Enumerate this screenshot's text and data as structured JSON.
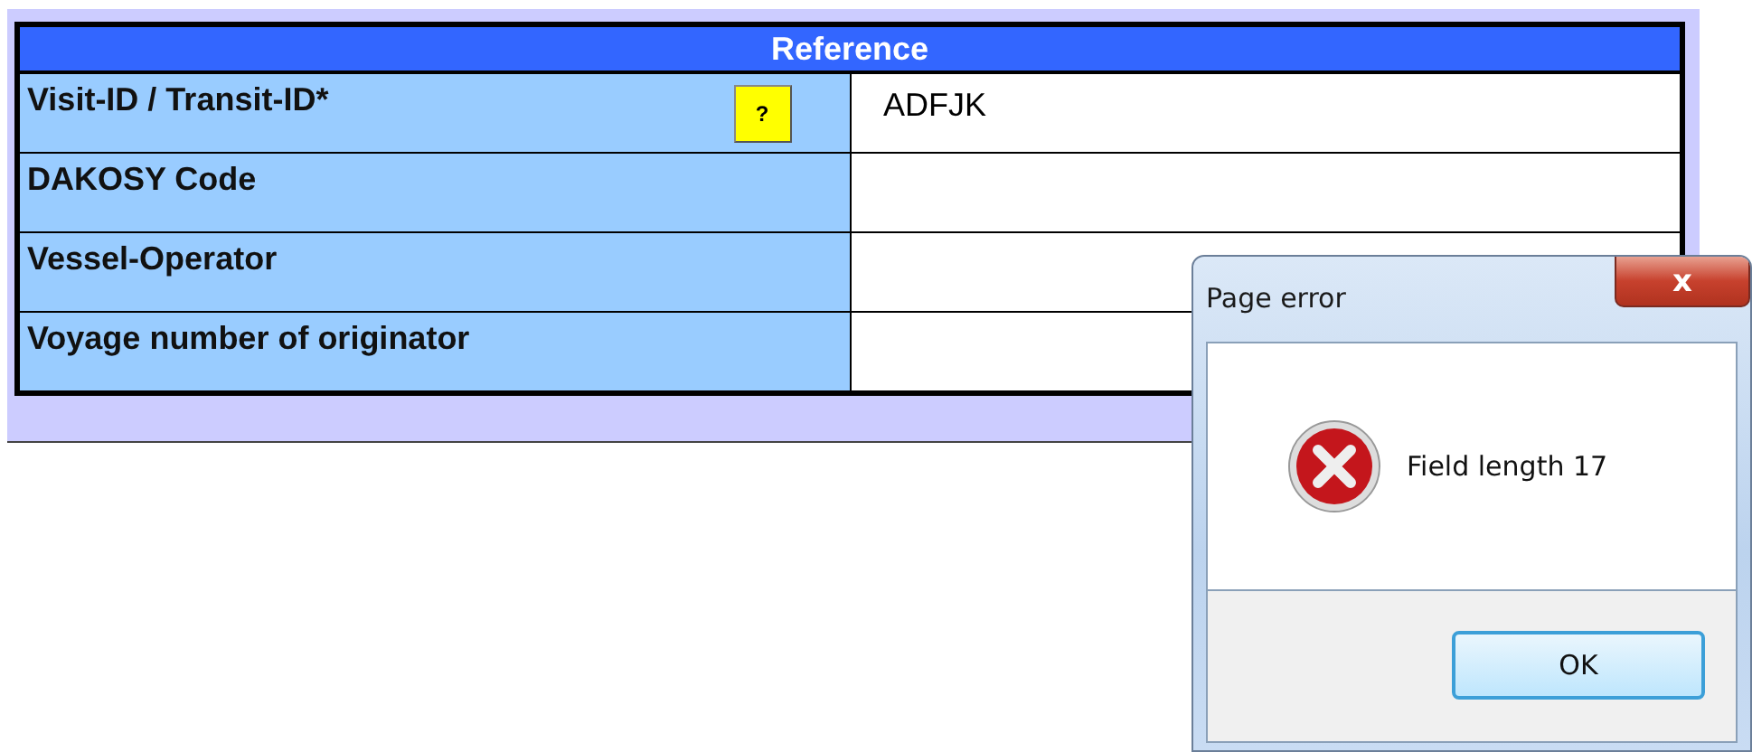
{
  "form": {
    "title": "Reference",
    "rows": [
      {
        "label": "Visit-ID / Transit-ID*",
        "help": "?",
        "value": "ADFJK"
      },
      {
        "label": "DAKOSY Code",
        "value": ""
      },
      {
        "label": "Vessel-Operator",
        "value": ""
      },
      {
        "label": "Voyage number of originator",
        "value": ""
      }
    ]
  },
  "dialog": {
    "title": "Page error",
    "close": "x",
    "message": "Field length 17",
    "buttons": [
      "OK"
    ]
  }
}
